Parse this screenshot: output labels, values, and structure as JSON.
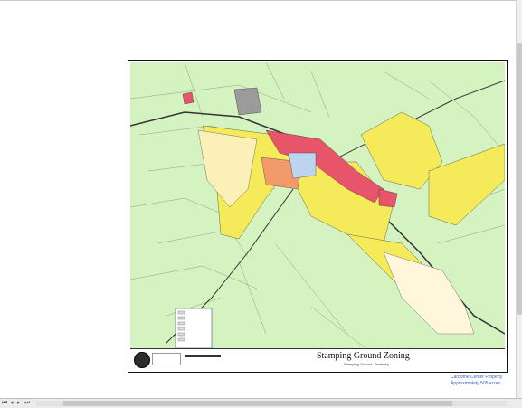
{
  "map": {
    "title": "Stamping Ground Zoning",
    "subtitle": "Stamping Ground, Kentucky"
  },
  "caption": {
    "line1": "Cardome Center Property",
    "line2": "Approximately 505 acres"
  },
  "icons": {
    "first_page": "first-page-icon",
    "prev_page": "previous-page-icon",
    "next_page": "next-page-icon",
    "last_page": "last-page-icon",
    "scroll_left": "scroll-left-icon",
    "scroll_right": "scroll-right-icon"
  },
  "colors": {
    "land": "#d4f3c1",
    "residential": "#f5eb5a",
    "commercial": "#e8546a",
    "light_residential": "#fbf0b8",
    "agricultural": "#fff6dc",
    "gray_parcel": "#9b9b9b",
    "public_use": "#bcd4f0",
    "orange_zone": "#f39a6b",
    "caption_text": "#3a5fbf"
  }
}
